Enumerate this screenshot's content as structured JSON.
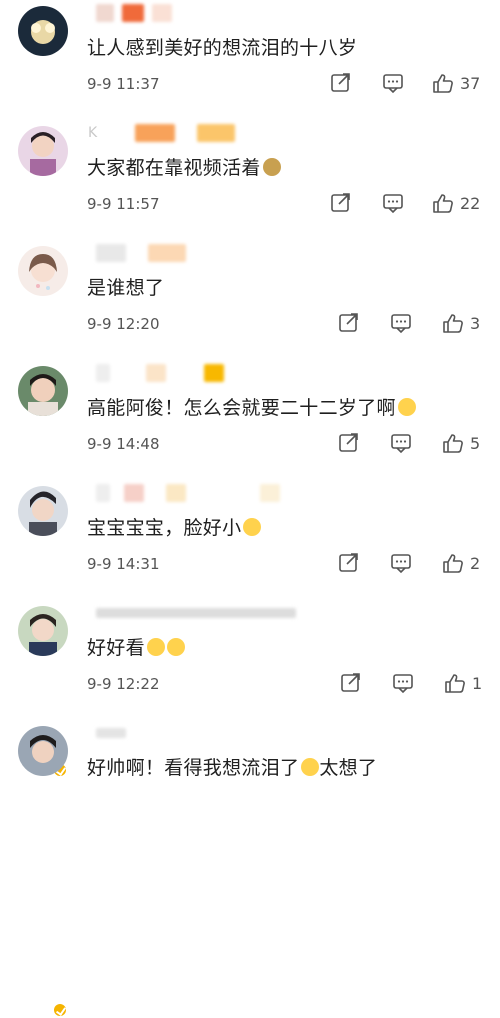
{
  "colors": {
    "meta": "#555555",
    "text": "#1f1f1f",
    "vip": "#f5b400"
  },
  "comments": [
    {
      "name": "",
      "text": "让人感到美好的想流泪的十八岁",
      "time": "9-9 11:37",
      "likes": "37"
    },
    {
      "name": "K",
      "text": "大家都在靠视频活着",
      "time": "9-9 11:57",
      "likes": "22"
    },
    {
      "name": "",
      "text": "是谁想了",
      "time": "9-9 12:20",
      "likes": "3"
    },
    {
      "name": "",
      "text": "高能阿俊！怎么会就要二十二岁了啊",
      "time": "9-9 14:48",
      "likes": "5"
    },
    {
      "name": "",
      "text": "宝宝宝宝，脸好小",
      "time": "9-9 14:31",
      "likes": "2"
    },
    {
      "name": "",
      "text": "好好看",
      "time": "9-9 12:22",
      "likes": "1"
    },
    {
      "name": "",
      "text": "好帅啊！看得我想流泪了",
      "text2": "太想了",
      "time": "",
      "likes": ""
    }
  ],
  "icons": {
    "share": "share-icon",
    "reply": "reply-icon",
    "like": "thumbs-up-icon"
  }
}
